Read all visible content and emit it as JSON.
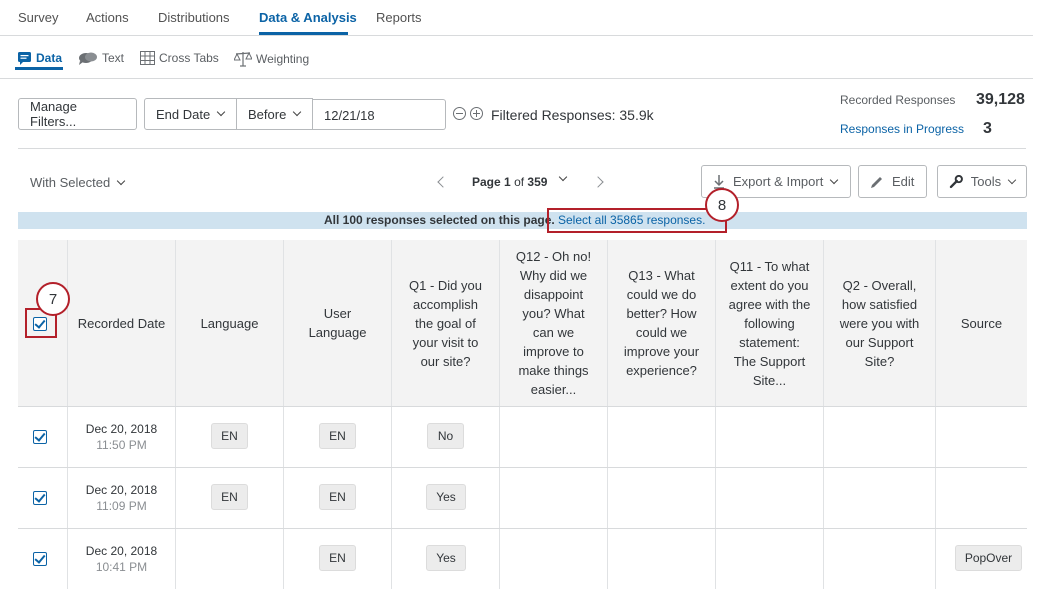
{
  "topnav": {
    "tabs": [
      "Survey",
      "Actions",
      "Distributions",
      "Data & Analysis",
      "Reports"
    ],
    "active": "Data & Analysis"
  },
  "subnav": {
    "tabs": [
      {
        "label": "Data",
        "icon": "data-icon"
      },
      {
        "label": "Text",
        "icon": "text-bubbles-icon"
      },
      {
        "label": "Cross Tabs",
        "icon": "grid-icon"
      },
      {
        "label": "Weighting",
        "icon": "scale-icon"
      }
    ],
    "active": "Data"
  },
  "filters": {
    "manage_label": "Manage Filters...",
    "field_label": "End Date",
    "operator_label": "Before",
    "value": "12/21/18",
    "filtered_text": "Filtered Responses: 35.9k"
  },
  "stats": {
    "recorded_label": "Recorded Responses",
    "recorded_value": "39,128",
    "progress_label": "Responses in Progress",
    "progress_value": "3"
  },
  "toolbar": {
    "with_selected": "With Selected",
    "page_prefix": "Page",
    "page_current": "1",
    "page_of": "of",
    "page_total": "359",
    "export_label": "Export & Import",
    "edit_label": "Edit",
    "tools_label": "Tools"
  },
  "banner": {
    "text": "All 100 responses selected on this page.",
    "link": "Select all 35865 responses."
  },
  "annotations": {
    "seven": "7",
    "eight": "8"
  },
  "table": {
    "headers": [
      "Recorded Date",
      "Language",
      "User Language",
      "Q1 - Did you accomplish the goal of your visit to our site?",
      "Q12 - Oh no! Why did we disappoint you? What can we improve to make things easier...",
      "Q13 - What could we do better? How could we improve your experience?",
      "Q11 - To what extent do you agree with the following statement: The Support Site...",
      "Q2 - Overall, how satisfied were you with our Support Site?",
      "Source"
    ],
    "rows": [
      {
        "date": "Dec 20, 2018",
        "time": "11:50 PM",
        "language": "EN",
        "user_language": "EN",
        "q1": "No",
        "source": ""
      },
      {
        "date": "Dec 20, 2018",
        "time": "11:09 PM",
        "language": "EN",
        "user_language": "EN",
        "q1": "Yes",
        "source": ""
      },
      {
        "date": "Dec 20, 2018",
        "time": "10:41 PM",
        "language": "",
        "user_language": "EN",
        "q1": "Yes",
        "source": "PopOver"
      }
    ]
  },
  "colors": {
    "accent": "#0b63a6",
    "highlight": "#b3202a",
    "banner": "#cfe2ef"
  }
}
